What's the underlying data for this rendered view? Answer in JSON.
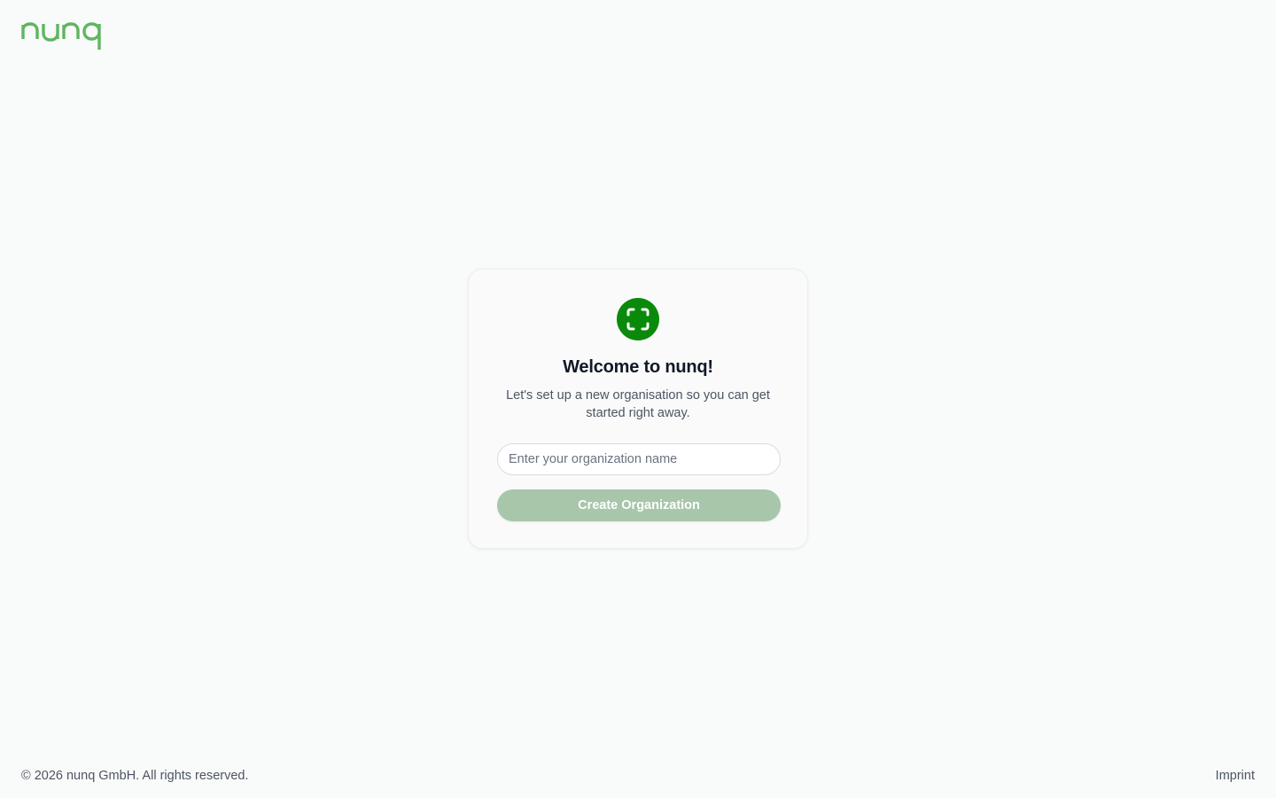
{
  "header": {
    "logo_text": "nunq",
    "logo_color": "#5fb660"
  },
  "onboarding": {
    "icon": "scan-frame-icon",
    "icon_color": "#0a8a0a",
    "title": "Welcome to nunq!",
    "subtitle": "Let's set up a new organisation so you can get started right away.",
    "org_name": {
      "value": "",
      "placeholder": "Enter your organization name"
    },
    "create_button_label": "Create Organization",
    "create_button_color": "#a7c6aa",
    "create_button_disabled": true
  },
  "footer": {
    "copyright": "© 2026 nunq GmbH. All rights reserved.",
    "imprint_label": "Imprint"
  }
}
